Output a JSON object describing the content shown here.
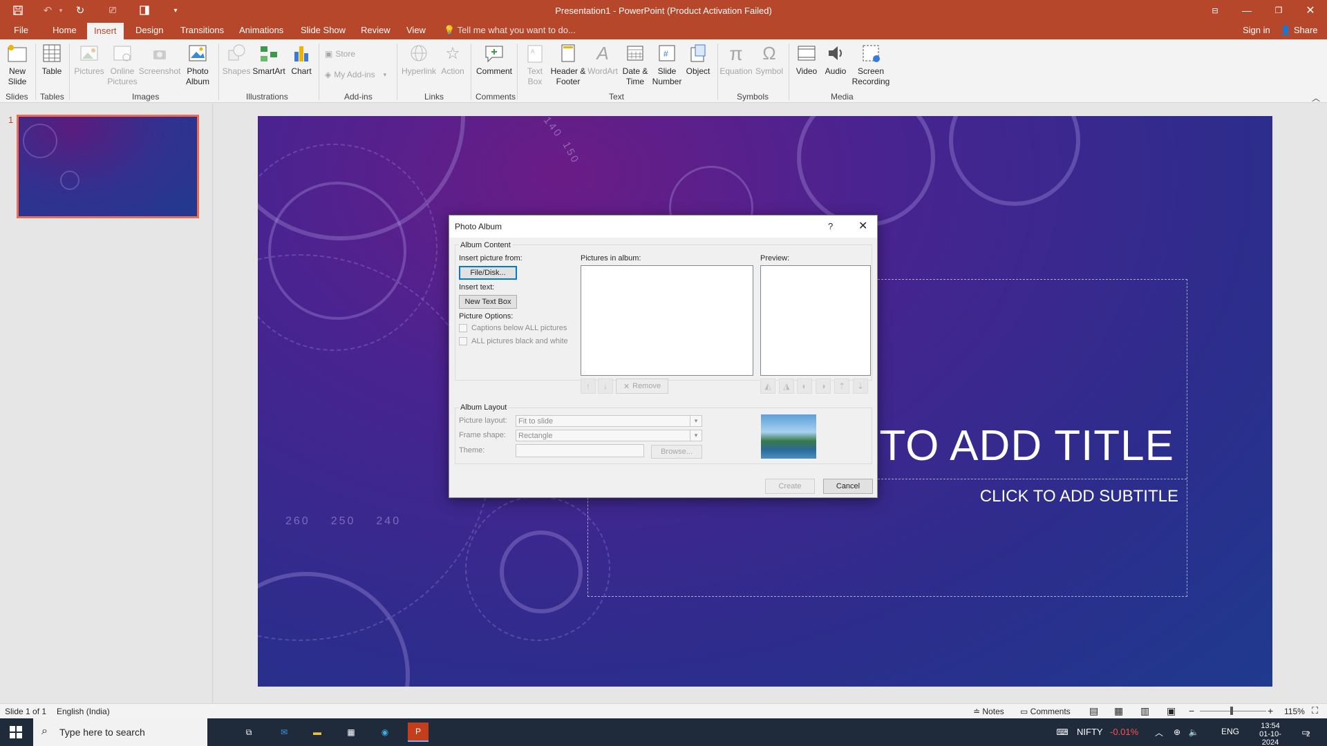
{
  "window": {
    "title": "Presentation1 - PowerPoint (Product Activation Failed)"
  },
  "tabs": [
    "File",
    "Home",
    "Insert",
    "Design",
    "Transitions",
    "Animations",
    "Slide Show",
    "Review",
    "View"
  ],
  "tell_me": "Tell me what you want to do...",
  "account": {
    "sign_in": "Sign in",
    "share": "Share"
  },
  "ribbon": {
    "new_slide": "New Slide",
    "table": "Table",
    "pictures": "Pictures",
    "online_pictures": "Online Pictures",
    "screenshot": "Screenshot",
    "photo_album": "Photo Album",
    "shapes": "Shapes",
    "smartart": "SmartArt",
    "chart": "Chart",
    "store": "Store",
    "my_addins": "My Add-ins",
    "hyperlink": "Hyperlink",
    "action": "Action",
    "comment": "Comment",
    "text_box": "Text Box",
    "header_footer": "Header & Footer",
    "wordart": "WordArt",
    "date_time": "Date & Time",
    "slide_number": "Slide Number",
    "object": "Object",
    "equation": "Equation",
    "symbol": "Symbol",
    "video": "Video",
    "audio": "Audio",
    "screen_recording": "Screen Recording",
    "groups": {
      "slides": "Slides",
      "tables": "Tables",
      "images": "Images",
      "illustrations": "Illustrations",
      "addins": "Add-ins",
      "links": "Links",
      "comments": "Comments",
      "text": "Text",
      "symbols": "Symbols",
      "media": "Media"
    }
  },
  "thumb_number": "1",
  "slide": {
    "title": "CLICK TO ADD TITLE",
    "subtitle": "CLICK TO ADD SUBTITLE",
    "dial_numbers": [
      "260",
      "250",
      "240",
      "150",
      "140"
    ]
  },
  "dialog": {
    "title": "Photo Album",
    "help": "?",
    "album_content": "Album Content",
    "insert_picture_from": "Insert picture from:",
    "file_disk": "File/Disk...",
    "insert_text": "Insert text:",
    "new_text_box": "New Text Box",
    "picture_options": "Picture Options:",
    "captions_below": "Captions below ALL pictures",
    "black_white": "ALL pictures black and white",
    "pictures_in_album": "Pictures in album:",
    "preview": "Preview:",
    "remove": "Remove",
    "album_layout": "Album Layout",
    "picture_layout": "Picture layout:",
    "picture_layout_value": "Fit to slide",
    "frame_shape": "Frame shape:",
    "frame_shape_value": "Rectangle",
    "theme": "Theme:",
    "theme_value": "",
    "browse": "Browse...",
    "create": "Create",
    "cancel": "Cancel"
  },
  "status": {
    "slide": "Slide 1 of 1",
    "language": "English (India)",
    "notes": "Notes",
    "comments": "Comments",
    "zoom": "115%"
  },
  "taskbar": {
    "search": "Type here to search",
    "nifty": "NIFTY",
    "nifty_change": "-0.01%",
    "lang": "ENG",
    "time": "13:54",
    "date": "01-10-2024",
    "notif": "2"
  },
  "colors": {
    "accent": "#b7472a",
    "thumb_border": "#f06b4f",
    "nifty_change": "#ff4f4f"
  }
}
